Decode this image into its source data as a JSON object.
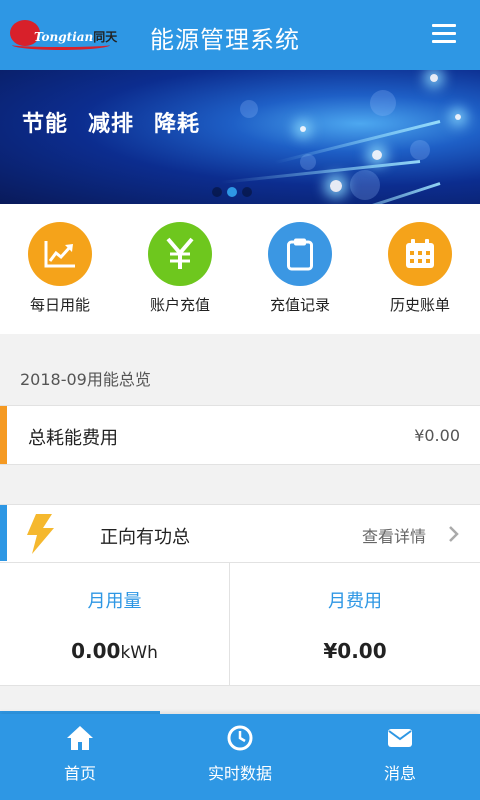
{
  "header": {
    "logo_text": "Tongtian",
    "logo_text_cn": "同天",
    "title": "能源管理系统"
  },
  "banner": {
    "slogan": [
      "节能",
      "减排",
      "降耗"
    ],
    "slide_count": 3,
    "active_slide": 2
  },
  "quick_menu": [
    {
      "label": "每日用能",
      "icon": "trend-chart-icon",
      "color": "#f5a31a"
    },
    {
      "label": "账户充值",
      "icon": "yen-icon",
      "color": "#6ec71e"
    },
    {
      "label": "充值记录",
      "icon": "clipboard-icon",
      "color": "#3b97e3"
    },
    {
      "label": "历史账单",
      "icon": "calendar-icon",
      "color": "#f5a31a"
    }
  ],
  "summary": {
    "title": "2018-09用能总览"
  },
  "total_cost": {
    "label": "总耗能费用",
    "value": "¥0.00"
  },
  "energy": {
    "label": "正向有功总",
    "detail_label": "查看详情",
    "usage_label": "月用量",
    "usage_value": "0.00",
    "usage_unit": "kWh",
    "cost_label": "月费用",
    "cost_value": "¥0.00"
  },
  "bottom_nav": [
    {
      "label": "首页",
      "icon": "home-icon"
    },
    {
      "label": "实时数据",
      "icon": "clock-icon"
    },
    {
      "label": "消息",
      "icon": "mail-icon"
    }
  ],
  "colors": {
    "primary": "#2e97e4",
    "orange": "#f59a23",
    "green": "#6ec71e"
  }
}
